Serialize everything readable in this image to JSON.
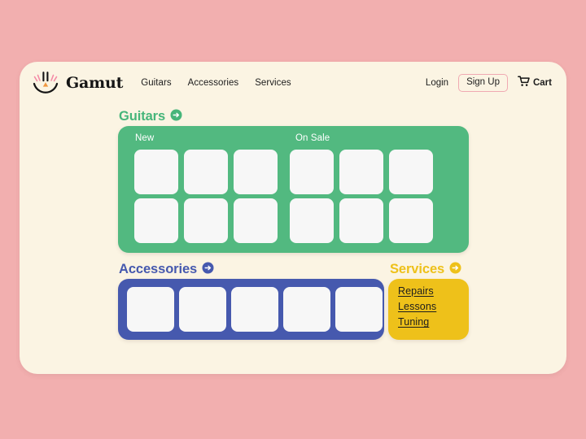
{
  "theme": {
    "page_background": "#f2afaf",
    "card_background": "#fbf4e3",
    "green": "#52b980",
    "blue": "#4659ae",
    "yellow": "#eec11a",
    "tile": "#f7f7f7",
    "signup_border": "#f0a9b2",
    "text": "#1d1d1d"
  },
  "header": {
    "logo_icon": "gamut-smile-logo-icon",
    "brand": "Gamut",
    "nav": [
      {
        "label": "Guitars"
      },
      {
        "label": "Accessories"
      },
      {
        "label": "Services"
      }
    ],
    "login_label": "Login",
    "signup_label": "Sign Up",
    "cart_icon": "shopping-cart-icon",
    "cart_label": "Cart"
  },
  "sections": {
    "guitars": {
      "title": "Guitars",
      "arrow_icon": "arrow-right-circle-icon",
      "groups": [
        {
          "label": "New",
          "tile_count": 6
        },
        {
          "label": "On Sale",
          "tile_count": 6
        }
      ]
    },
    "accessories": {
      "title": "Accessories",
      "arrow_icon": "arrow-right-circle-icon",
      "tile_count": 5
    },
    "services": {
      "title": "Services",
      "arrow_icon": "arrow-right-circle-icon",
      "links": [
        {
          "label": "Repairs"
        },
        {
          "label": "Lessons"
        },
        {
          "label": "Tuning"
        }
      ]
    }
  }
}
